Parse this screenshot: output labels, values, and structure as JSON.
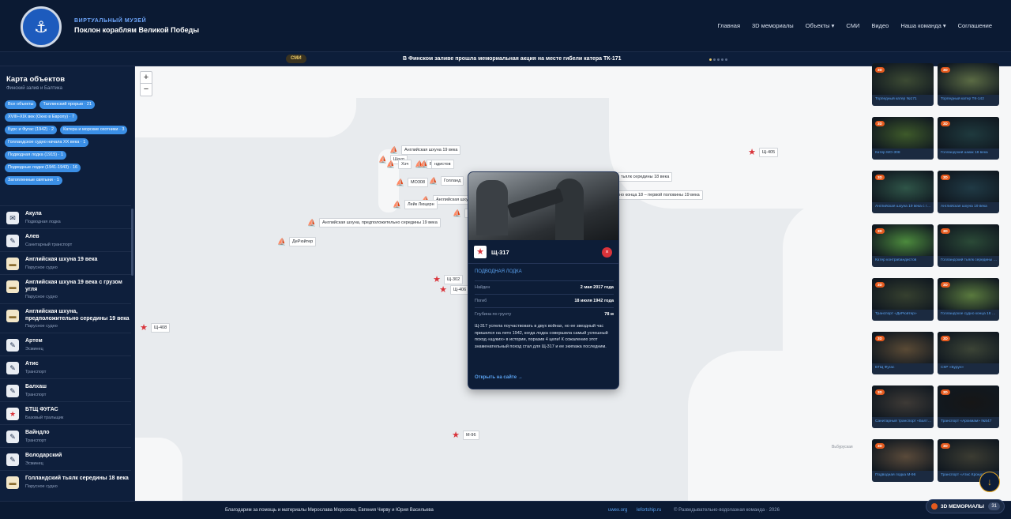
{
  "header": {
    "brand_sub": "ВИРТУАЛЬНЫЙ МУЗЕЙ",
    "brand_title": "Поклон кораблям Великой Победы",
    "nav": [
      "Главная",
      "3D мемориалы",
      "Объекты ▾",
      "СМИ",
      "Видео",
      "Наша команда ▾",
      "Соглашение"
    ]
  },
  "ticker": {
    "badge": "СМИ",
    "text": "В Финском заливе прошла мемориальная акция на месте гибели катера ТК-171"
  },
  "sidebar": {
    "title": "Карта объектов",
    "subtitle": "Финский залив и Балтика",
    "chips": [
      "Все объекты",
      "Таллинский прорыв · 21",
      "XVIII–XIX век (Окно в Европу) · 7",
      "Бурс и Фугас (1942) · 2",
      "Катера и морские охотники · 3",
      "Голландское судно начала XX века · 1",
      "Подводная лодка (1915) · 1",
      "Подводные лодки (1941-1943) · 16",
      "Затопленные святыни · 1"
    ],
    "items": [
      {
        "name": "Акула",
        "type": "Подводная лодка",
        "icon": "dark"
      },
      {
        "name": "Алев",
        "type": "Санитарный транспорт",
        "icon": "dark"
      },
      {
        "name": "Английская шхуна 19 века",
        "type": "Парусное судно",
        "icon": "sand"
      },
      {
        "name": "Английская шхуна 19 века с грузом угля",
        "type": "Парусное судно",
        "icon": "sand"
      },
      {
        "name": "Английская шхуна, предположительно середины 19 века",
        "type": "Парусное судно",
        "icon": "sand"
      },
      {
        "name": "Артем",
        "type": "Эсминец",
        "icon": "dark"
      },
      {
        "name": "Атис",
        "type": "Транспорт",
        "icon": "dark"
      },
      {
        "name": "Балхаш",
        "type": "Транспорт",
        "icon": "dark"
      },
      {
        "name": "БТЩ ФУГАС",
        "type": "Базовый тральщик",
        "icon": "red"
      },
      {
        "name": "Вайндло",
        "type": "Транспорт",
        "icon": "dark"
      },
      {
        "name": "Володарский",
        "type": "Эсминец",
        "icon": "dark"
      },
      {
        "name": "Голландский тьялк середины 18 века",
        "type": "Парусное судно",
        "icon": "sand"
      }
    ]
  },
  "map": {
    "zoom_in": "+",
    "zoom_out": "−",
    "markers": [
      {
        "label": "Английская шхуна 19 века",
        "kind": "ship"
      },
      {
        "label": "Шаул",
        "kind": "ship"
      },
      {
        "label": "Хэч",
        "kind": "ship"
      },
      {
        "label": "ВП",
        "kind": "ship"
      },
      {
        "label": "ндистов",
        "kind": "ship"
      },
      {
        "label": "MO308",
        "kind": "ship"
      },
      {
        "label": "Голланд",
        "kind": "ship"
      },
      {
        "label": "Английская шху",
        "kind": "ship"
      },
      {
        "label": "Лейк Люцерн",
        "kind": "ship"
      },
      {
        "label": "ТК",
        "kind": "ship"
      },
      {
        "label": "Английская шхуна, предположительно середины 19 века",
        "kind": "ship"
      },
      {
        "label": "ДеРюйтер",
        "kind": "ship"
      },
      {
        "label": "тьялк середины 18 века",
        "kind": "ship"
      },
      {
        "label": "но конца 18 – первой половины 19 века",
        "kind": "ship"
      },
      {
        "label": "Щ-405",
        "kind": "star"
      },
      {
        "label": "Щ-302",
        "kind": "star"
      },
      {
        "label": "Щ-406",
        "kind": "star"
      },
      {
        "label": "Щ-408",
        "kind": "star"
      },
      {
        "label": "М-96",
        "kind": "star"
      }
    ],
    "watermark": "Вьбуруская"
  },
  "popup": {
    "title": "Щ-317",
    "close": "×",
    "category": "ПОДВОДНАЯ ЛОДКА",
    "rows": [
      {
        "k": "Найден",
        "v": "2 мая 2017 года"
      },
      {
        "k": "Погиб",
        "v": "18 июля 1942 года"
      },
      {
        "k": "Глубина по грунту",
        "v": "78 м"
      }
    ],
    "description": "Щ-317 успела поучаствовать в двух войнах, но ее звездный час пришелся на лето 1942, когда лодка совершила самый успешный поход «щуких» в истории, поразив 4 цели! К сожалению этот знаменательный поход стал для Щ-317 и ее экипажа последним.",
    "link": "Открыть на сайте →"
  },
  "gallery": {
    "badge": "3D",
    "cards": [
      {
        "caption": "Торпедный катер №171",
        "color": "#3c4a33"
      },
      {
        "caption": "Торпедный катер ТК-142",
        "color": "#5b6b44"
      },
      {
        "caption": "Катер МО-308",
        "color": "#3e5a2a"
      },
      {
        "caption": "Голландский шмак 18 века",
        "color": "#1f3a3e"
      },
      {
        "caption": "Английская шхуна 19 века с грузом угля",
        "color": "#2f5548"
      },
      {
        "caption": "Английская шхуна 19 века",
        "color": "#203a45"
      },
      {
        "caption": "Катер контрабандистов",
        "color": "#4c8a3d"
      },
      {
        "caption": "Голландский тьялк середины 18 века",
        "color": "#2b4a37"
      },
      {
        "caption": "Транспорт «ДеРюйтер»",
        "color": "#36402f"
      },
      {
        "caption": "Голландское судно конца 18 — первой половины 19 века",
        "color": "#5a7a3e"
      },
      {
        "caption": "БТЩ Фугас",
        "color": "#5a4a35"
      },
      {
        "caption": "СКР «Бурун»",
        "color": "#3c4436"
      },
      {
        "caption": "Санитарный транспорт «Балтика» №524",
        "color": "#3e3a36"
      },
      {
        "caption": "Транспорт «Архимам» №547",
        "color": "#161616"
      },
      {
        "caption": "Подводная лодка М-96",
        "color": "#5a4a3a"
      },
      {
        "caption": "Транспорт «Атис Крондвальдс» №538",
        "color": "#3c3c32"
      }
    ]
  },
  "footer": {
    "credits": "Благодарим за помощь и материалы Мирослава Морозова, Евгения Чирву и Юрия Васильева",
    "link1": "uwex.org",
    "link2": "lefortship.ru",
    "copyright": "© Разведывательно-водолазная команда · 2026",
    "memorials_label": "3D МЕМОРИАЛЫ",
    "memorials_count": "31"
  },
  "colors": {
    "accent": "#3b8fe6",
    "background": "#0b1a33",
    "danger": "#d9333a",
    "badge3d": "#e55a1e"
  }
}
